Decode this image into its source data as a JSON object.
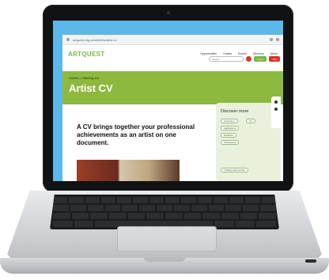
{
  "browser": {
    "url": "artquest.org.uk/articles/artist-cv"
  },
  "site": {
    "logo": "ARTQUEST",
    "nav": [
      "Opportunities",
      "Guides",
      "Events",
      "Directory",
      "About"
    ],
    "search_placeholder": "Search",
    "login_label": "Log in",
    "join_label": "Join"
  },
  "hero": {
    "breadcrumb": "Guides > Starting out",
    "title": "Artist CV",
    "background": "#8db93f"
  },
  "main": {
    "lede": "A CV brings together your professional achievements as an artist on one document."
  },
  "sidebar": {
    "title": "Discover more",
    "tags": [
      "Curriculum",
      "CV",
      "Applications",
      "Exhibition",
      "Professional",
      "Writing"
    ],
    "link": "Thinking about profile"
  },
  "colors": {
    "brand_green": "#7ab648",
    "brand_red": "#d9342b",
    "screen_backdrop": "#5bb8e8"
  }
}
